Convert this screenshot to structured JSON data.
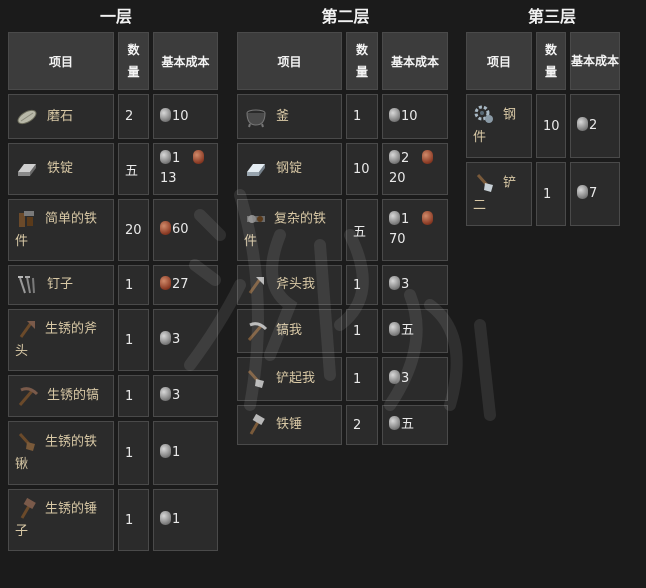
{
  "tiers": [
    {
      "title": "一层",
      "headers": {
        "item": "项目",
        "qty": "数量",
        "cost": "基本成本"
      },
      "rows": [
        {
          "icon": "whetstone-icon",
          "name": "磨石",
          "qty": "2",
          "costs": [
            {
              "type": "iron",
              "value": "10"
            }
          ]
        },
        {
          "icon": "iron-ingot-icon",
          "name": "铁锭",
          "qty": "五",
          "costs": [
            {
              "type": "iron",
              "value": "1"
            },
            {
              "type": "copper",
              "value": "13"
            }
          ]
        },
        {
          "icon": "simple-ironware-icon",
          "name": "简单的铁件",
          "qty": "20",
          "costs": [
            {
              "type": "copper",
              "value": "60"
            }
          ]
        },
        {
          "icon": "nails-icon",
          "name": "钉子",
          "qty": "1",
          "costs": [
            {
              "type": "copper",
              "value": "27"
            }
          ]
        },
        {
          "icon": "rusty-axe-icon",
          "name": "生锈的斧头",
          "qty": "1",
          "costs": [
            {
              "type": "iron",
              "value": "3"
            }
          ]
        },
        {
          "icon": "rusty-pickaxe-icon",
          "name": "生锈的镐",
          "qty": "1",
          "costs": [
            {
              "type": "iron",
              "value": "3"
            }
          ]
        },
        {
          "icon": "rusty-shovel-icon",
          "name": "生锈的铁锹",
          "qty": "1",
          "costs": [
            {
              "type": "iron",
              "value": "1"
            }
          ]
        },
        {
          "icon": "rusty-hammer-icon",
          "name": "生锈的锤子",
          "qty": "1",
          "costs": [
            {
              "type": "iron",
              "value": "1"
            }
          ]
        }
      ]
    },
    {
      "title": "第二层",
      "headers": {
        "item": "项目",
        "qty": "数量",
        "cost": "基本成本"
      },
      "rows": [
        {
          "icon": "cauldron-icon",
          "name": "釜",
          "qty": "1",
          "costs": [
            {
              "type": "iron",
              "value": "10"
            }
          ]
        },
        {
          "icon": "steel-ingot-icon",
          "name": "钢锭",
          "qty": "10",
          "costs": [
            {
              "type": "iron",
              "value": "2"
            },
            {
              "type": "copper",
              "value": "20"
            }
          ]
        },
        {
          "icon": "complex-ironware-icon",
          "name": "复杂的铁件",
          "qty": "五",
          "costs": [
            {
              "type": "iron",
              "value": "1"
            },
            {
              "type": "copper",
              "value": "70"
            }
          ]
        },
        {
          "icon": "axe-icon",
          "name": "斧头我",
          "qty": "1",
          "costs": [
            {
              "type": "iron",
              "value": "3"
            }
          ]
        },
        {
          "icon": "pickaxe-icon",
          "name": "镐我",
          "qty": "1",
          "costs": [
            {
              "type": "iron",
              "value": "五"
            }
          ]
        },
        {
          "icon": "shovel-icon",
          "name": "铲起我",
          "qty": "1",
          "costs": [
            {
              "type": "iron",
              "value": "3"
            }
          ]
        },
        {
          "icon": "iron-hammer-icon",
          "name": "铁锤",
          "qty": "2",
          "costs": [
            {
              "type": "iron",
              "value": "五"
            }
          ]
        }
      ]
    },
    {
      "title": "第三层",
      "headers": {
        "item": "项目",
        "qty": "数量",
        "cost": "基本成本"
      },
      "rows": [
        {
          "icon": "steel-parts-icon",
          "name": "钢件",
          "qty": "10",
          "costs": [
            {
              "type": "iron",
              "value": "2"
            }
          ]
        },
        {
          "icon": "shovel-ii-icon",
          "name": "铲二",
          "qty": "1",
          "costs": [
            {
              "type": "iron",
              "value": "7"
            }
          ]
        }
      ]
    }
  ],
  "colors": {
    "background": "#1b1b1b",
    "cell": "#2b2b2b",
    "header": "#3c3c3c",
    "item_text": "#d9c9a6",
    "iron_coin": "#9a9a9a",
    "copper_coin": "#8a3a24"
  }
}
